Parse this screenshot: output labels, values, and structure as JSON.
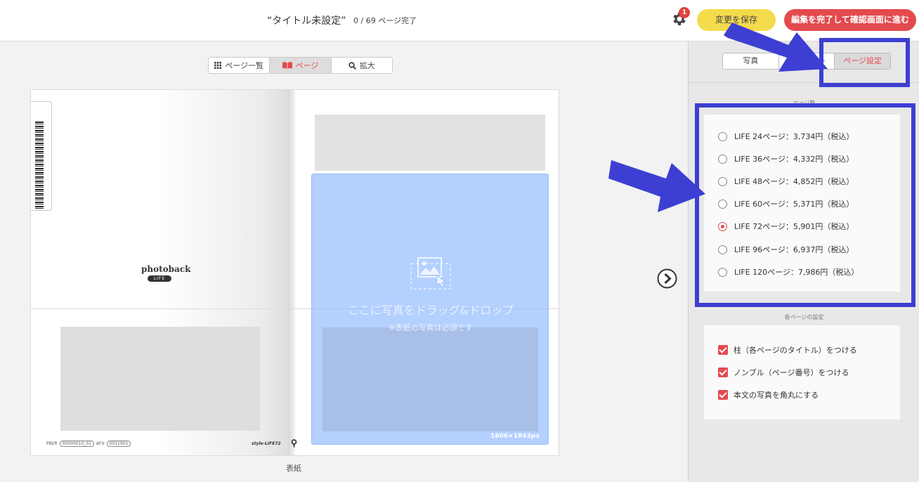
{
  "header": {
    "title": "“タイトル未設定”",
    "progress": "0 / 69 ページ完了",
    "notification_count": "1",
    "save_button": "変更を保存",
    "finish_button": "編集を完了して確認画面に進む"
  },
  "view_tabs": [
    {
      "label": "ページ一覧",
      "icon": "grid-icon"
    },
    {
      "label": "ページ",
      "icon": "book-icon",
      "active": true
    },
    {
      "label": "拡大",
      "icon": "search-icon"
    }
  ],
  "spread": {
    "logo": {
      "name": "photoback",
      "sub": "LIFE"
    },
    "footer": {
      "pber_label": "PBER",
      "pber_code": "00000010_01",
      "afv_label": "AFV",
      "afv_code": "0011001",
      "style_code": "style-LIFE72"
    },
    "dropzone": {
      "main_text": "ここに写真をドラッグ&ドロップ",
      "sub_text": "※表紙の写真は必須です",
      "size": "1606×1843px"
    },
    "page_label": "表紙"
  },
  "panel": {
    "tabs": [
      {
        "label": "写真"
      },
      {
        "label": "レイアウト"
      },
      {
        "label": "ページ設定",
        "active": true
      }
    ],
    "page_count_title": "ページ数",
    "page_options": [
      {
        "label": "LIFE 24ページ：3,734円（税込）",
        "selected": false
      },
      {
        "label": "LIFE 36ページ：4,332円（税込）",
        "selected": false
      },
      {
        "label": "LIFE 48ページ：4,852円（税込）",
        "selected": false
      },
      {
        "label": "LIFE 60ページ：5,371円（税込）",
        "selected": false
      },
      {
        "label": "LIFE 72ページ：5,901円（税込）",
        "selected": true
      },
      {
        "label": "LIFE 96ページ：6,937円（税込）",
        "selected": false
      },
      {
        "label": "LIFE 120ページ：7,986円（税込）",
        "selected": false
      }
    ],
    "settings_title": "各ページの設定",
    "settings": [
      {
        "label": "柱（各ページのタイトル）をつける",
        "checked": true
      },
      {
        "label": "ノンブル（ページ番号）をつける",
        "checked": true
      },
      {
        "label": "本文の写真を角丸にする",
        "checked": true
      }
    ]
  },
  "colors": {
    "accent": "#e34a4e",
    "save": "#f4db4c",
    "annotation": "#3d3fd3",
    "dropzone": "#96beff"
  }
}
